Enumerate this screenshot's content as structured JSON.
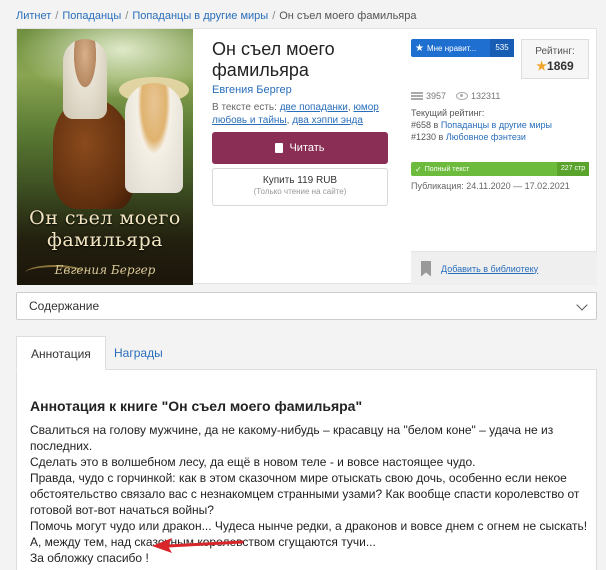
{
  "breadcrumb": [
    "Литнет",
    "Попаданцы",
    "Попаданцы в другие миры",
    "Он съел моего фамильяра"
  ],
  "breadcrumb_sep": "/",
  "cover": {
    "title_line1": "Он съел моего",
    "title_line2": "фамильяра",
    "author": "Евгения Бергер"
  },
  "book": {
    "title": "Он съел моего фамильяра",
    "author": "Евгения Бергер",
    "tags_prefix": "В тексте есть:",
    "tags": [
      "две попаданки",
      "юмор",
      "любовь и тайны",
      "два хэппи энда"
    ]
  },
  "buttons": {
    "read": "Читать",
    "buy": "Купить 119 RUB",
    "buy_note": "(Только чтение на сайте)",
    "like": "Мне нравит...",
    "like_count": "535",
    "add_library": "Добавить в библиотеку"
  },
  "rating": {
    "label": "Рейтинг:",
    "value": "1869"
  },
  "stats": {
    "library_count": "3957",
    "views": "132311"
  },
  "current_rating": {
    "label": "Текущий рейтинг:",
    "rank1": "#658 в",
    "rank1_link": "Попаданцы в другие миры",
    "rank2": "#1230 в",
    "rank2_link": "Любовное фэнтези"
  },
  "status": {
    "full_text": "Полный текст",
    "pages": "227 стр",
    "publication": "Публикация: 24.11.2020 — 17.02.2021"
  },
  "contents_label": "Содержание",
  "tabs": [
    "Аннотация",
    "Награды"
  ],
  "annotation": {
    "heading": "Аннотация к книге \"Он съел моего фамильяра\"",
    "lines": [
      "Свалиться на голову мужчине, да не какому-нибудь – красавцу на \"белом коне\" – удача не из последних.",
      "Сделать это в волшебном лесу, да ещё в новом теле - и вовсе настоящее чудо.",
      "Правда, чудо с горчинкой: как в этом сказочном мире отыскать свою дочь, особенно если некое обстоятельство связало вас с незнакомцем странными узами? Как вообще спасти королевство от готовой вот-вот начаться войны?",
      "Помочь могут чудо или дракон... Чудеса нынче редки, а драконов и вовсе днем с огнем не сыскать!",
      "А, между тем, над сказочным королевством сгущаются тучи...",
      "За обложку спасибо !"
    ]
  },
  "colors": {
    "read_button": "#8a2e55",
    "like_button": "#1e6fd0",
    "full_text_badge": "#6cbb3c",
    "link": "#2a6ebb",
    "arrow": "#d9262a"
  }
}
